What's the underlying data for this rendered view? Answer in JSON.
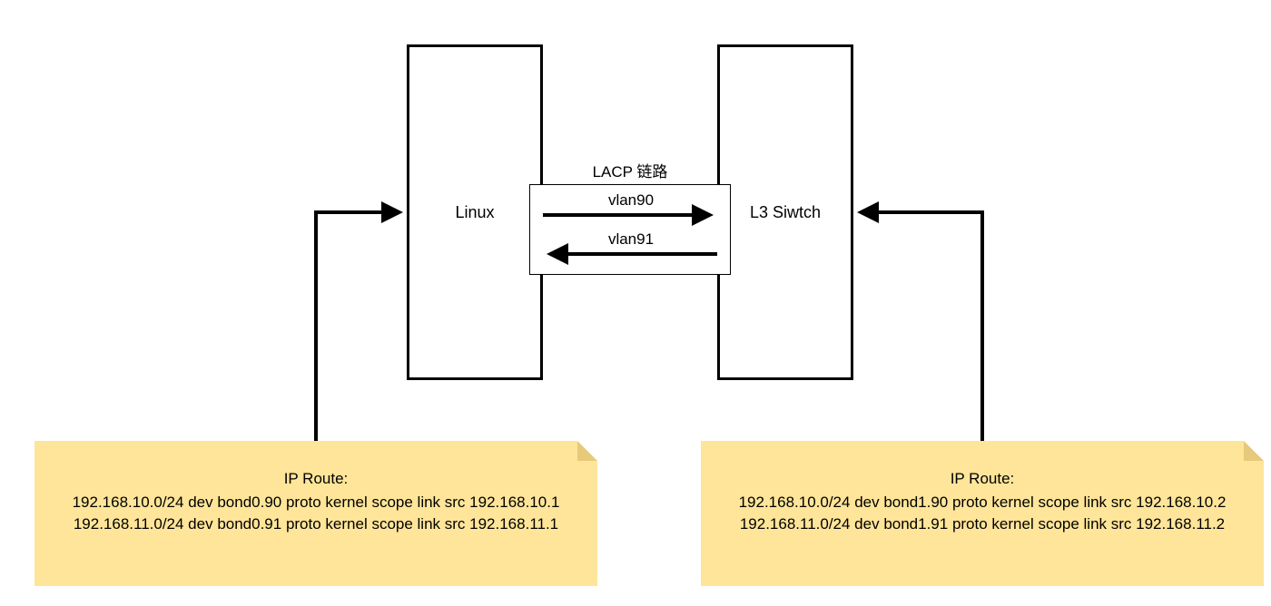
{
  "nodes": {
    "linux": {
      "label": "Linux"
    },
    "switch": {
      "label": "L3 Siwtch"
    }
  },
  "link": {
    "group_label": "LACP 链路",
    "vlan_top": "vlan90",
    "vlan_bottom": "vlan91"
  },
  "notes": {
    "left": {
      "title": "IP Route:",
      "line1": "192.168.10.0/24 dev bond0.90 proto kernel scope link src 192.168.10.1",
      "line2": "192.168.11.0/24 dev bond0.91 proto kernel scope link src 192.168.11.1"
    },
    "right": {
      "title": "IP Route:",
      "line1": "192.168.10.0/24 dev bond1.90 proto kernel scope link src 192.168.10.2",
      "line2": "192.168.11.0/24 dev bond1.91 proto kernel scope link src 192.168.11.2"
    }
  }
}
